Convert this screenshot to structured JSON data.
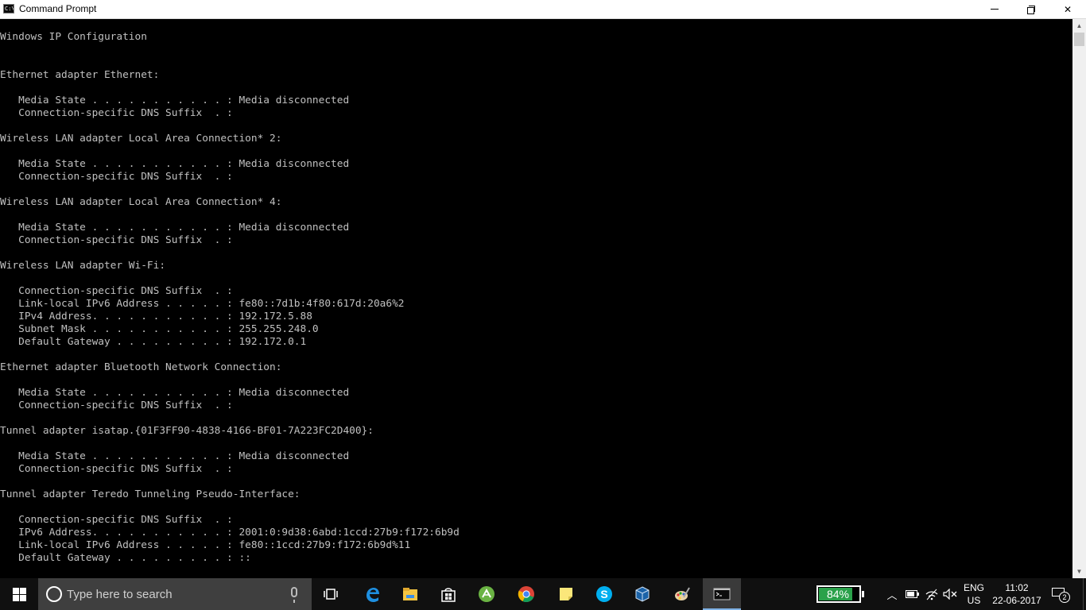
{
  "window": {
    "title": "Command Prompt",
    "icon": "cmd-icon"
  },
  "console": {
    "lines": [
      "Windows IP Configuration",
      "",
      "",
      "Ethernet adapter Ethernet:",
      "",
      "   Media State . . . . . . . . . . . : Media disconnected",
      "   Connection-specific DNS Suffix  . :",
      "",
      "Wireless LAN adapter Local Area Connection* 2:",
      "",
      "   Media State . . . . . . . . . . . : Media disconnected",
      "   Connection-specific DNS Suffix  . :",
      "",
      "Wireless LAN adapter Local Area Connection* 4:",
      "",
      "   Media State . . . . . . . . . . . : Media disconnected",
      "   Connection-specific DNS Suffix  . :",
      "",
      "Wireless LAN adapter Wi-Fi:",
      "",
      "   Connection-specific DNS Suffix  . :",
      "   Link-local IPv6 Address . . . . . : fe80::7d1b:4f80:617d:20a6%2",
      "   IPv4 Address. . . . . . . . . . . : 192.172.5.88",
      "   Subnet Mask . . . . . . . . . . . : 255.255.248.0",
      "   Default Gateway . . . . . . . . . : 192.172.0.1",
      "",
      "Ethernet adapter Bluetooth Network Connection:",
      "",
      "   Media State . . . . . . . . . . . : Media disconnected",
      "   Connection-specific DNS Suffix  . :",
      "",
      "Tunnel adapter isatap.{01F3FF90-4838-4166-BF01-7A223FC2D400}:",
      "",
      "   Media State . . . . . . . . . . . : Media disconnected",
      "   Connection-specific DNS Suffix  . :",
      "",
      "Tunnel adapter Teredo Tunneling Pseudo-Interface:",
      "",
      "   Connection-specific DNS Suffix  . :",
      "   IPv6 Address. . . . . . . . . . . : 2001:0:9d38:6abd:1ccd:27b9:f172:6b9d",
      "   Link-local IPv6 Address . . . . . : fe80::1ccd:27b9:f172:6b9d%11",
      "   Default Gateway . . . . . . . . . : ::"
    ]
  },
  "taskbar": {
    "search_placeholder": "Type here to search",
    "apps": [
      {
        "name": "task-view-icon"
      },
      {
        "name": "edge-icon"
      },
      {
        "name": "file-explorer-icon"
      },
      {
        "name": "store-icon"
      },
      {
        "name": "android-studio-icon"
      },
      {
        "name": "chrome-icon"
      },
      {
        "name": "sticky-notes-icon"
      },
      {
        "name": "skype-icon"
      },
      {
        "name": "virtualbox-icon"
      },
      {
        "name": "paint-icon"
      },
      {
        "name": "command-prompt-icon",
        "active": true
      }
    ],
    "battery_percent_label": "84%",
    "battery_level": 0.84,
    "language": "ENG",
    "keyboard_layout": "US",
    "time": "11:02",
    "date": "22-06-2017",
    "notification_count": "2"
  },
  "colors": {
    "console_bg": "#000000",
    "console_text": "#c0c0c0",
    "taskbar_bg": "#101010",
    "battery_fill": "#2aa14a",
    "active_indicator": "#7fb2e5"
  }
}
